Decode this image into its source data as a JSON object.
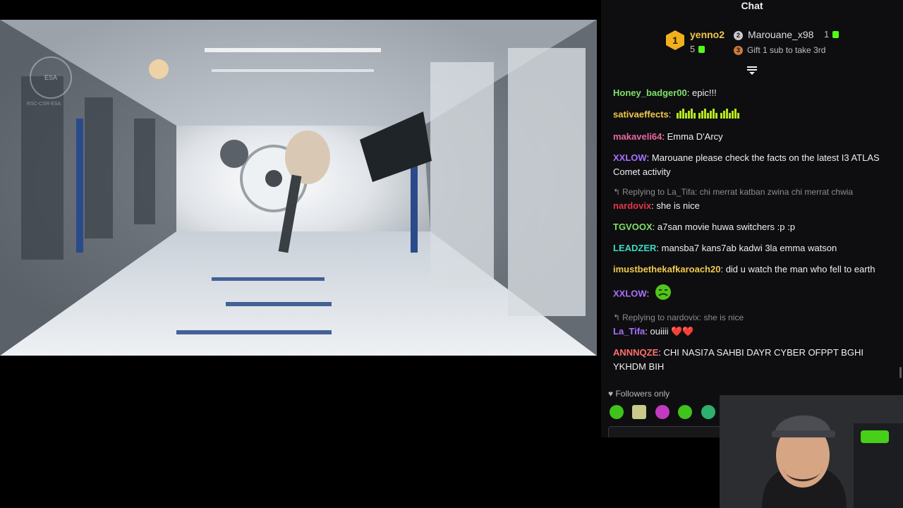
{
  "video": {
    "logo_text": "ESA",
    "caption_text": "RSC-CSR-ESA"
  },
  "chat": {
    "title": "Chat",
    "leaderboard": {
      "first": {
        "rank": "1",
        "name": "yenno2",
        "count": "5"
      },
      "second": {
        "rank": "2",
        "name": "Marouane_x98",
        "count": "1"
      },
      "third": {
        "rank": "3",
        "text": "Gift 1 sub to take 3rd"
      }
    },
    "messages": [
      {
        "user": "Honey_badger00",
        "color": "#7ee06a",
        "text": "epic!!!"
      },
      {
        "user": "sativaeffects",
        "color": "#f2c94c",
        "text": "",
        "emotes": "bars"
      },
      {
        "user": "makaveli64",
        "color": "#e868a0",
        "text": "Emma D'Arcy"
      },
      {
        "user": "XXLOW",
        "color": "#a970ff",
        "text": "Marouane please check the facts on the latest I3 ATLAS Comet activity"
      },
      {
        "reply": "Replying to La_Tifa: chi merrat katban zwina chi merrat chwia",
        "user": "nardovix",
        "color": "#e8344a",
        "text": "she is nice"
      },
      {
        "user": "TGVOOX",
        "color": "#7ee06a",
        "text": "a7san movie huwa switchers :p :p"
      },
      {
        "user": "LEADZER",
        "color": "#3ddbc0",
        "text": "mansba7 kans7ab kadwi 3la emma watson"
      },
      {
        "user": "imustbethekafkaroach20",
        "color": "#f2c94c",
        "text": "did u watch the man who fell to earth"
      },
      {
        "user": "XXLOW",
        "color": "#a970ff",
        "text": "",
        "emotes": "face"
      },
      {
        "reply": "Replying to nardovix: she is nice",
        "user": "La_Tifa",
        "color": "#a970ff",
        "text": "ouiiii ❤️❤️"
      },
      {
        "user": "ANNNQZE",
        "color": "#ff6e6e",
        "text": "CHI NASI7A SAHBI DAYR CYBER OFPPT BGHI YKHDM BIH"
      }
    ],
    "followers_only": "Followers only",
    "colors": {
      "accent": "#53fc18",
      "background": "#0e0e10"
    }
  }
}
